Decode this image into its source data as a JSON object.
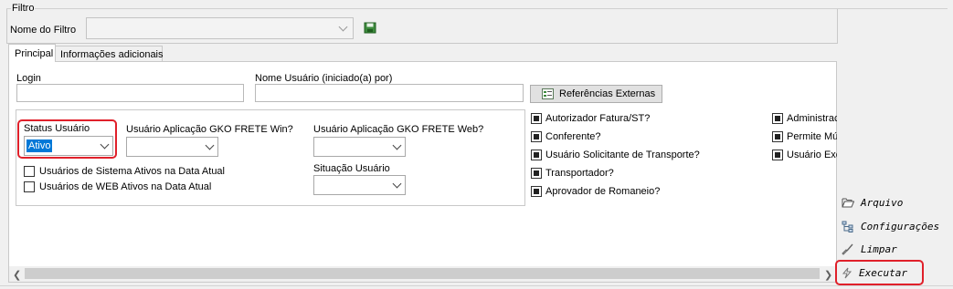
{
  "filter": {
    "group_title": "Filtro",
    "name_label": "Nome do Filtro",
    "name_value": ""
  },
  "tabs": [
    {
      "label": "Principal",
      "active": true
    },
    {
      "label": "Informações adicionais",
      "active": false
    }
  ],
  "fields": {
    "login_label": "Login",
    "login_value": "",
    "nome_usuario_label": "Nome Usuário (iniciado(a) por)",
    "nome_usuario_value": "",
    "ref_externas_label": "Referências Externas",
    "status_label": "Status Usuário",
    "status_value": "Ativo",
    "app_win_label": "Usuário Aplicação GKO FRETE Win?",
    "app_win_value": "",
    "app_web_label": "Usuário Aplicação GKO FRETE Web?",
    "app_web_value": "",
    "situacao_label": "Situação Usuário",
    "situacao_value": ""
  },
  "left_checks": [
    {
      "label": "Usuários de Sistema Ativos na Data Atual",
      "checked": false
    },
    {
      "label": "Usuários de WEB Ativos na Data Atual",
      "checked": false
    }
  ],
  "mid_checks": [
    {
      "label": "Autorizador Fatura/ST?",
      "checked": true
    },
    {
      "label": "Conferente?",
      "checked": true
    },
    {
      "label": "Usuário Solicitante de Transporte?",
      "checked": true
    },
    {
      "label": "Transportador?",
      "checked": true
    },
    {
      "label": "Aprovador de Romaneio?",
      "checked": true
    }
  ],
  "right_checks": [
    {
      "label": "Administrac",
      "checked": true
    },
    {
      "label": "Permite Mú",
      "checked": true
    },
    {
      "label": "Usuário Exe",
      "checked": true
    }
  ],
  "side_actions": [
    {
      "label": "Arquivo",
      "icon": "folder-open-icon"
    },
    {
      "label": "Configurações",
      "icon": "settings-tree-icon"
    },
    {
      "label": "Limpar",
      "icon": "broom-icon"
    },
    {
      "label": "Executar",
      "icon": "lightning-icon"
    }
  ],
  "colors": {
    "highlight": "#e0202a",
    "selection": "#0078d7"
  }
}
